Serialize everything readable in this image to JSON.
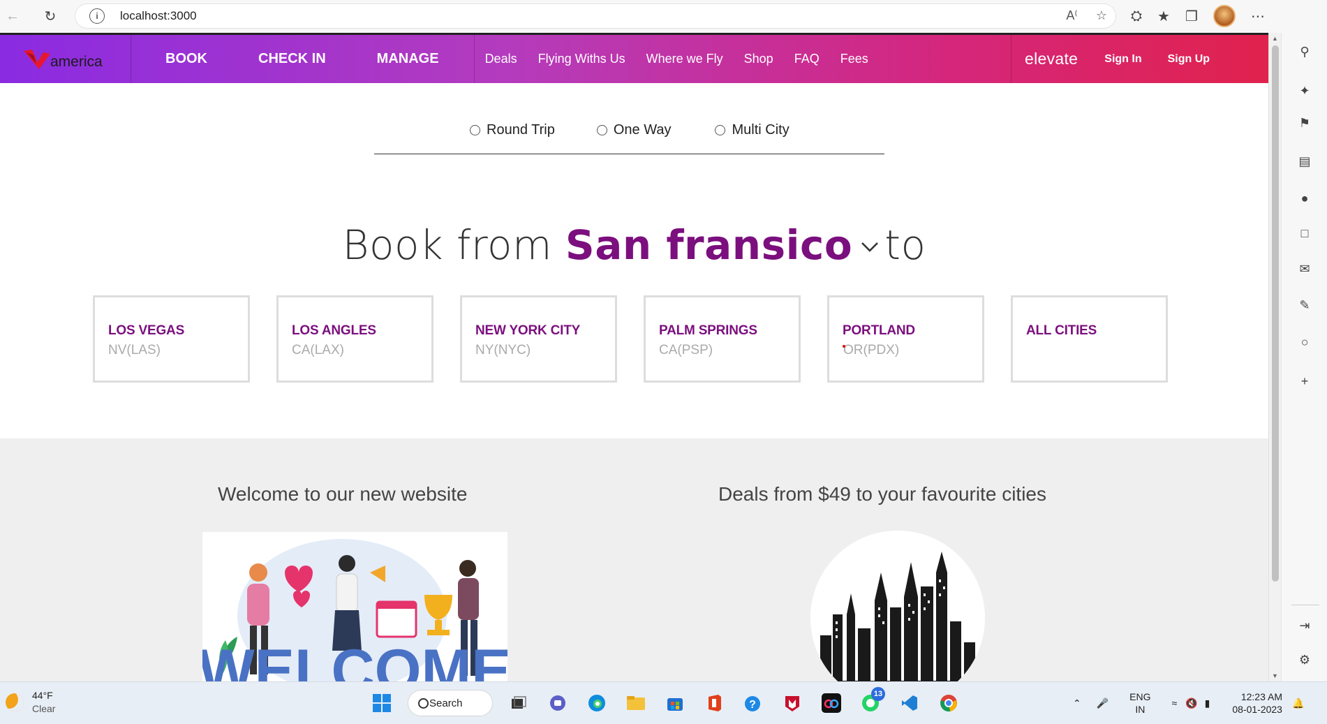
{
  "browser": {
    "url": "localhost:3000",
    "icons": [
      "back-icon",
      "reload-icon",
      "info-icon",
      "read-aloud-icon",
      "favorite-add-icon",
      "extensions-icon",
      "favorites-icon",
      "collections-icon",
      "profile-avatar",
      "more-icon"
    ]
  },
  "site": {
    "logo_word": "america",
    "primary_nav": [
      "BOOK",
      "CHECK IN",
      "MANAGE"
    ],
    "secondary_nav": [
      "Deals",
      "Flying Withs Us",
      "Where we Fly",
      "Shop",
      "FAQ",
      "Fees"
    ],
    "account": {
      "brand": "elevate",
      "sign_in": "Sign In",
      "sign_up": "Sign Up"
    },
    "colors": {
      "header_start": "#8a2be2",
      "header_end": "#e0224d",
      "accent": "#7b0f7e"
    }
  },
  "trip_types": [
    "Round Trip",
    "One Way",
    "Multi City"
  ],
  "hero": {
    "prefix": "Book from",
    "city": "San fransico",
    "suffix": "to"
  },
  "cities": [
    {
      "name": "LOS VEGAS",
      "code": "NV(LAS)"
    },
    {
      "name": "LOS ANGLES",
      "code": "CA(LAX)"
    },
    {
      "name": "NEW YORK CITY",
      "code": "NY(NYC)"
    },
    {
      "name": "PALM SPRINGS",
      "code": "CA(PSP)"
    },
    {
      "name": "PORTLAND",
      "code": "OR(PDX)"
    },
    {
      "name": "ALL CITIES",
      "code": ""
    }
  ],
  "lower": {
    "welcome_title": "Welcome to our new website",
    "deals_title": "Deals from $49 to your favourite cities",
    "welcome_image_text": "WELCOME"
  },
  "taskbar": {
    "temperature": "44°F",
    "condition": "Clear",
    "search_label": "Search",
    "whatsapp_badge": "13",
    "lang_top": "ENG",
    "lang_bottom": "IN",
    "time": "12:23 AM",
    "date": "08-01-2023"
  }
}
